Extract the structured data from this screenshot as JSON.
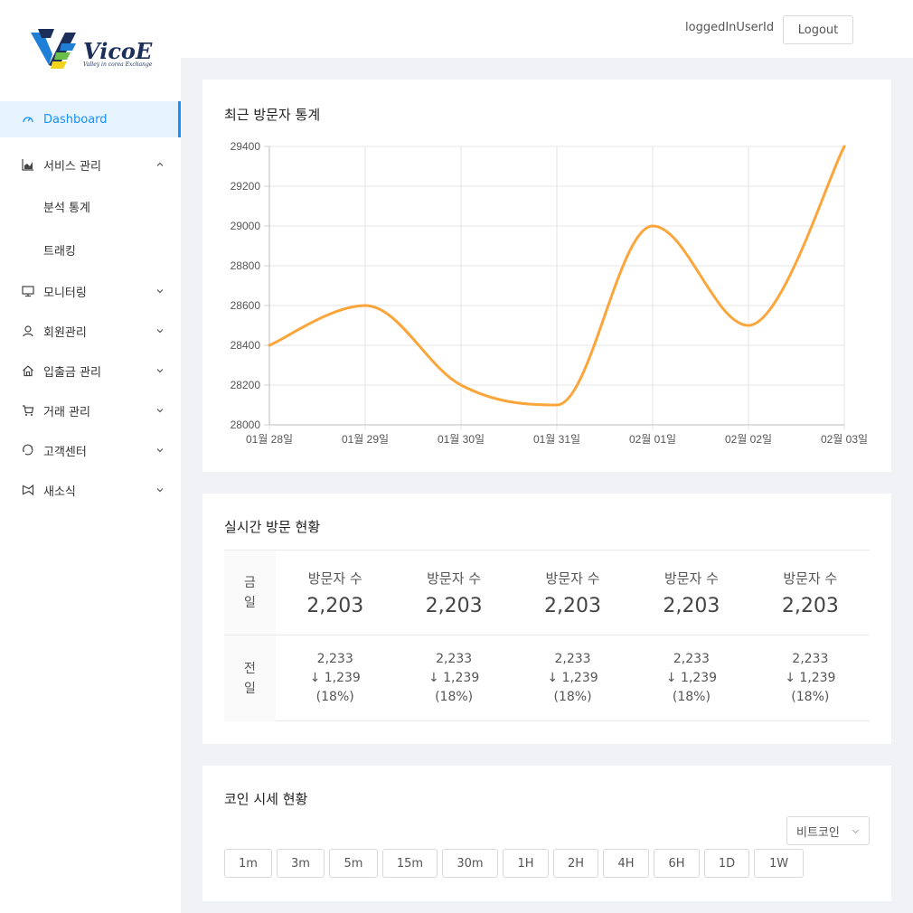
{
  "brand": {
    "name": "VicoE",
    "tagline": "Valley in corea Exchange",
    "colors": {
      "navy": "#1c2e5a",
      "blue": "#1f7fd6",
      "green": "#6cc04a",
      "yellow": "#f2d21b"
    }
  },
  "header": {
    "user": "loggedInUserId",
    "logout_label": "Logout"
  },
  "sidebar": {
    "accent": "#1890ff",
    "items": [
      {
        "label": "Dashboard",
        "icon": "dashboard-icon",
        "active": true
      },
      {
        "label": "서비스 관리",
        "icon": "area-chart-icon",
        "expanded": true,
        "children": [
          {
            "label": "분석 통계"
          },
          {
            "label": "트래킹"
          }
        ]
      },
      {
        "label": "모니터링",
        "icon": "desktop-icon"
      },
      {
        "label": "회원관리",
        "icon": "user-icon"
      },
      {
        "label": "입출금 관리",
        "icon": "home-icon"
      },
      {
        "label": "거래 관리",
        "icon": "cart-icon"
      },
      {
        "label": "고객센터",
        "icon": "sync-icon"
      },
      {
        "label": "새소식",
        "icon": "notification-icon"
      }
    ]
  },
  "visitor_chart": {
    "title": "최근 방문자 통계",
    "line_color": "#fba53b"
  },
  "chart_data": {
    "type": "line",
    "x": [
      "01월 28일",
      "01월 29일",
      "01월 30일",
      "01월 31일",
      "02월 01일",
      "02월 02일",
      "02월 03일"
    ],
    "series": [
      {
        "values": [
          28400,
          28600,
          28200,
          28100,
          29000,
          28500,
          29400
        ]
      }
    ],
    "yticks": [
      28000,
      28200,
      28400,
      28600,
      28800,
      29000,
      29200,
      29400
    ],
    "ylim": [
      28000,
      29400
    ],
    "grid": true,
    "title": "",
    "xlabel": "",
    "ylabel": ""
  },
  "realtime": {
    "title": "실시간 방문 현황",
    "today_label": [
      "금",
      "일"
    ],
    "yesterday_label": [
      "전",
      "일"
    ],
    "today": [
      {
        "label": "방문자 수",
        "value": "2,203"
      },
      {
        "label": "방문자 수",
        "value": "2,203"
      },
      {
        "label": "방문자 수",
        "value": "2,203"
      },
      {
        "label": "방문자 수",
        "value": "2,203"
      },
      {
        "label": "방문자 수",
        "value": "2,203"
      }
    ],
    "yesterday": [
      {
        "total": "2,233",
        "diff": "↓ 1,239",
        "pct": "(18%)"
      },
      {
        "total": "2,233",
        "diff": "↓ 1,239",
        "pct": "(18%)"
      },
      {
        "total": "2,233",
        "diff": "↓ 1,239",
        "pct": "(18%)"
      },
      {
        "total": "2,233",
        "diff": "↓ 1,239",
        "pct": "(18%)"
      },
      {
        "total": "2,233",
        "diff": "↓ 1,239",
        "pct": "(18%)"
      }
    ]
  },
  "coin": {
    "title": "코인 시세 현황",
    "selected": "비트코인",
    "intervals": [
      "1m",
      "3m",
      "5m",
      "15m",
      "30m",
      "1H",
      "2H",
      "4H",
      "6H",
      "1D",
      "1W"
    ]
  }
}
